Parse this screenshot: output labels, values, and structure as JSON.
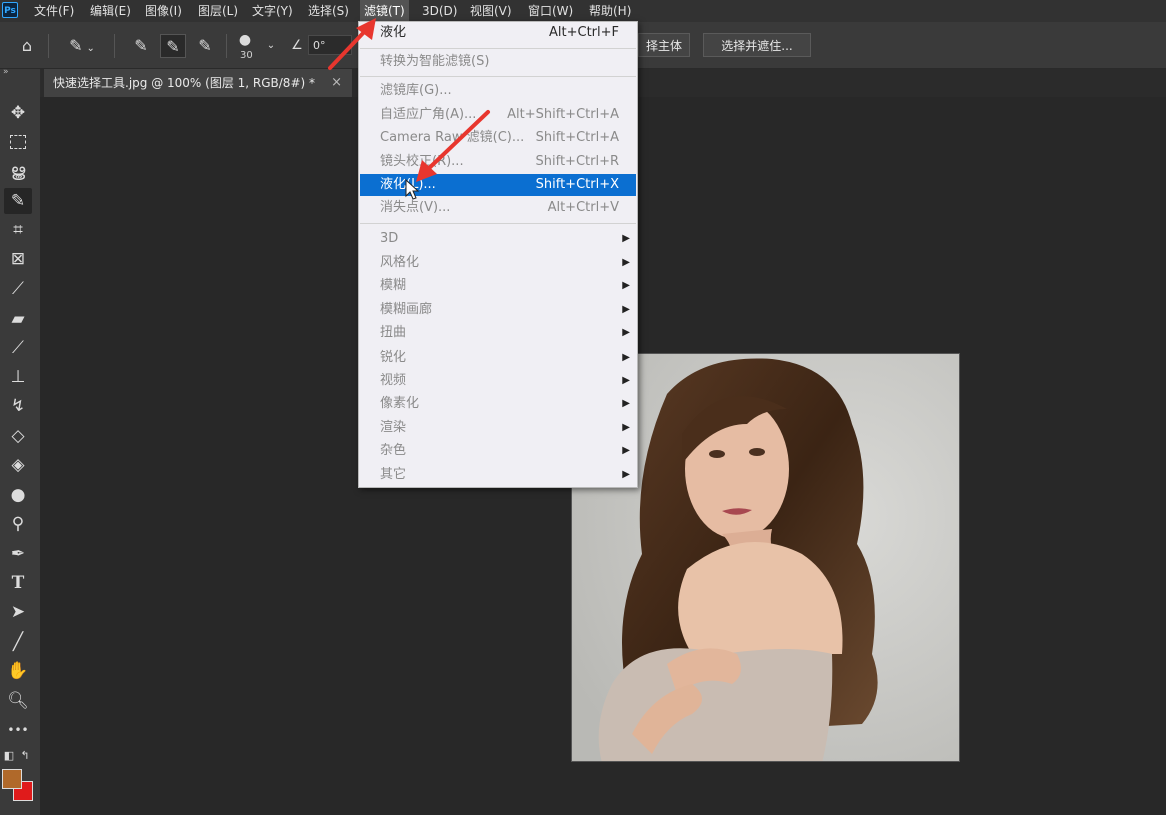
{
  "app": {
    "logo": "Ps"
  },
  "menubar": {
    "items": [
      "文件(F)",
      "编辑(E)",
      "图像(I)",
      "图层(L)",
      "文字(Y)",
      "选择(S)",
      "滤镜(T)",
      "3D(D)",
      "视图(V)",
      "窗口(W)",
      "帮助(H)"
    ],
    "active_index": 6
  },
  "options": {
    "brush_size": "30",
    "angle": "0°",
    "select_subject": "择主体",
    "select_and_mask": "选择并遮住..."
  },
  "document": {
    "tab_title": "快速选择工具.jpg @ 100% (图层 1, RGB/8#) *",
    "close": "×"
  },
  "toolbar": {
    "collapse": "»",
    "more": "•••"
  },
  "colors": {
    "foreground": "#b0692a",
    "background": "#e01b1b",
    "highlight": "#0b6fd1"
  },
  "filter_menu": {
    "items": [
      {
        "label": "液化",
        "shortcut": "Alt+Ctrl+F",
        "enabled": true
      },
      {
        "label": "转换为智能滤镜(S)",
        "shortcut": "",
        "enabled": false
      },
      {
        "label": "滤镜库(G)...",
        "shortcut": "",
        "enabled": false
      },
      {
        "label": "自适应广角(A)...",
        "shortcut": "Alt+Shift+Ctrl+A",
        "enabled": false
      },
      {
        "label": "Camera Raw 滤镜(C)...",
        "shortcut": "Shift+Ctrl+A",
        "enabled": false
      },
      {
        "label": "镜头校正(R)...",
        "shortcut": "Shift+Ctrl+R",
        "enabled": false
      },
      {
        "label": "液化(L)...",
        "shortcut": "Shift+Ctrl+X",
        "enabled": true,
        "highlighted": true
      },
      {
        "label": "消失点(V)...",
        "shortcut": "Alt+Ctrl+V",
        "enabled": false
      },
      {
        "label": "3D",
        "submenu": true,
        "enabled": false
      },
      {
        "label": "风格化",
        "submenu": true,
        "enabled": false
      },
      {
        "label": "模糊",
        "submenu": true,
        "enabled": false
      },
      {
        "label": "模糊画廊",
        "submenu": true,
        "enabled": false
      },
      {
        "label": "扭曲",
        "submenu": true,
        "enabled": false
      },
      {
        "label": "锐化",
        "submenu": true,
        "enabled": false
      },
      {
        "label": "视频",
        "submenu": true,
        "enabled": false
      },
      {
        "label": "像素化",
        "submenu": true,
        "enabled": false
      },
      {
        "label": "渲染",
        "submenu": true,
        "enabled": false
      },
      {
        "label": "杂色",
        "submenu": true,
        "enabled": false
      },
      {
        "label": "其它",
        "submenu": true,
        "enabled": false
      }
    ]
  }
}
